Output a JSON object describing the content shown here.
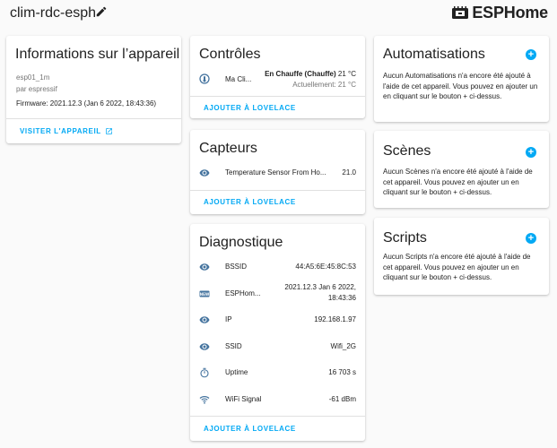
{
  "header": {
    "device_name": "clim-rdc-esph",
    "brand": "ESPHome"
  },
  "info": {
    "title": "Informations sur l’appareil",
    "model": "esp01_1m",
    "manufacturer": "par espressif",
    "firmware": "Firmware: 2021.12.3 (Jan 6 2022, 18:43:36)",
    "action": "VISITER L'APPAREIL"
  },
  "controls": {
    "title": "Contrôles",
    "entity": "Ma Cli...",
    "state_bold": "En Chauffe (Chauffe)",
    "state_temp": "21 °C",
    "current": "Actuellement: 21 °C",
    "action": "AJOUTER À LOVELACE"
  },
  "sensors": {
    "title": "Capteurs",
    "entity": "Temperature Sensor From Ho...",
    "value": "21.0",
    "action": "AJOUTER À LOVELACE"
  },
  "diagnostic": {
    "title": "Diagnostique",
    "rows": [
      {
        "icon": "eye-icon",
        "name": "BSSID",
        "value": "44:A5:6E:45:8C:53"
      },
      {
        "icon": "new-badge-icon",
        "name": "ESPHom...",
        "value": "2021.12.3 Jan 6 2022,",
        "value2": "18:43:36"
      },
      {
        "icon": "eye-icon",
        "name": "IP",
        "value": "192.168.1.97"
      },
      {
        "icon": "eye-icon",
        "name": "SSID",
        "value": "Wifi_2G"
      },
      {
        "icon": "timer-icon",
        "name": "Uptime",
        "value": "16 703 s"
      },
      {
        "icon": "wifi-icon",
        "name": "WiFi Signal",
        "value": "-61 dBm"
      }
    ],
    "action": "AJOUTER À LOVELACE"
  },
  "automations": {
    "title": "Automatisations",
    "desc": "Aucun Automatisations n'a encore été ajouté à l'aide de cet appareil. Vous pouvez en ajouter un en cliquant sur le bouton + ci-dessus."
  },
  "scenes": {
    "title": "Scènes",
    "desc": "Aucun Scènes n'a encore été ajouté à l'aide de cet appareil. Vous pouvez en ajouter un en cliquant sur le bouton + ci-dessus."
  },
  "scripts": {
    "title": "Scripts",
    "desc": "Aucun Scripts n'a encore été ajouté à l'aide de cet appareil. Vous pouvez en ajouter un en cliquant sur le bouton + ci-dessus."
  },
  "colors": {
    "accent": "#03a9f4",
    "icon": "#44739e",
    "text": "#212121",
    "secondary": "#757575"
  }
}
